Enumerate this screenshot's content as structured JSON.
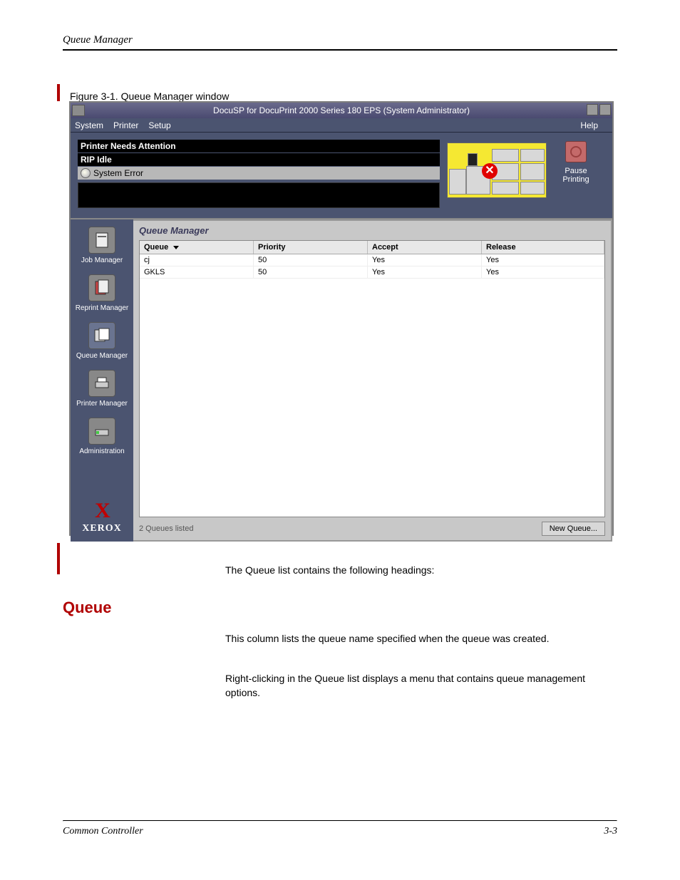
{
  "page": {
    "chapter": "Queue Manager",
    "figure_label": "Figure 3-1. Queue Manager window",
    "body1": "The Queue list contains the following headings:",
    "body2": "Right-clicking in the Queue list displays a menu that contains queue management options.",
    "heading_queue": "Queue",
    "queue_para": "This column lists the queue name specified when the queue was created.",
    "footer_title": "Common Controller",
    "footer_page": "3-3"
  },
  "app": {
    "title": "DocuSP for DocuPrint 2000 Series 180 EPS (System Administrator)",
    "menubar": {
      "system": "System",
      "printer": "Printer",
      "setup": "Setup",
      "help": "Help"
    },
    "status": {
      "line1": "Printer Needs Attention",
      "line2": "RIP Idle",
      "line3": "System Error"
    },
    "pause": {
      "label1": "Pause",
      "label2": "Printing"
    },
    "sidebar": {
      "job": "Job Manager",
      "reprint": "Reprint Manager",
      "queue": "Queue Manager",
      "printer": "Printer Manager",
      "admin": "Administration",
      "xerox": "XEROX"
    },
    "pane": {
      "title": "Queue Manager",
      "headers": {
        "queue": "Queue",
        "priority": "Priority",
        "accept": "Accept",
        "release": "Release"
      },
      "rows": [
        {
          "queue": "cj",
          "priority": "50",
          "accept": "Yes",
          "release": "Yes"
        },
        {
          "queue": "GKLS",
          "priority": "50",
          "accept": "Yes",
          "release": "Yes"
        }
      ],
      "count": "2 Queues listed",
      "new_queue": "New Queue..."
    }
  }
}
